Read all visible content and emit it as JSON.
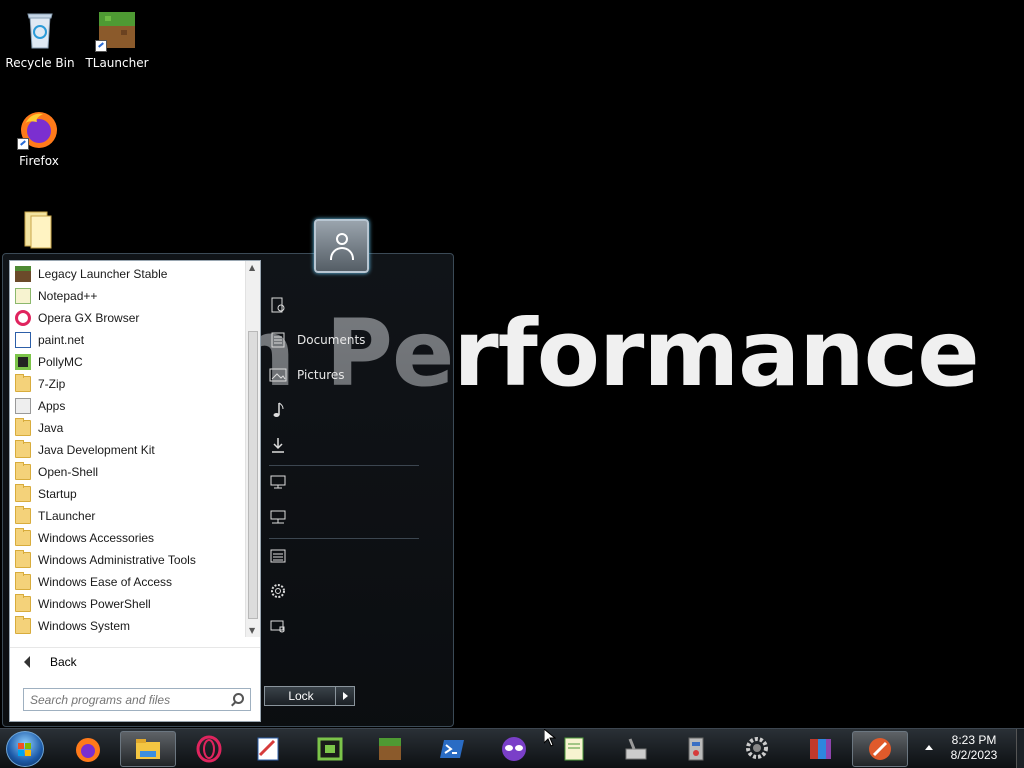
{
  "desktop": {
    "icons": [
      {
        "label": "Recycle Bin"
      },
      {
        "label": "TLauncher"
      },
      {
        "label": "Firefox"
      }
    ],
    "wallpaper_text": "n Performance"
  },
  "start_menu": {
    "programs": [
      {
        "label": "Legacy Launcher Stable",
        "icon": "minecraft-block-icon"
      },
      {
        "label": "Notepad++",
        "icon": "notepadpp-icon"
      },
      {
        "label": "Opera GX Browser",
        "icon": "opera-icon"
      },
      {
        "label": "paint.net",
        "icon": "paintnet-icon"
      },
      {
        "label": "PollyMC",
        "icon": "pollymc-icon"
      },
      {
        "label": "7-Zip",
        "icon": "folder-icon"
      },
      {
        "label": "Apps",
        "icon": "apps-icon"
      },
      {
        "label": "Java",
        "icon": "folder-icon"
      },
      {
        "label": "Java Development Kit",
        "icon": "folder-icon"
      },
      {
        "label": "Open-Shell",
        "icon": "folder-icon"
      },
      {
        "label": "Startup",
        "icon": "folder-icon"
      },
      {
        "label": "TLauncher",
        "icon": "folder-icon"
      },
      {
        "label": "Windows Accessories",
        "icon": "folder-icon"
      },
      {
        "label": "Windows Administrative Tools",
        "icon": "folder-icon"
      },
      {
        "label": "Windows Ease of Access",
        "icon": "folder-icon"
      },
      {
        "label": "Windows PowerShell",
        "icon": "folder-icon"
      },
      {
        "label": "Windows System",
        "icon": "folder-icon"
      }
    ],
    "back_label": "Back",
    "search_placeholder": "Search programs and files",
    "right_items": [
      {
        "label": "",
        "icon": "user-files-icon"
      },
      {
        "label": "Documents",
        "icon": "document-icon"
      },
      {
        "label": "Pictures",
        "icon": "picture-icon"
      },
      {
        "label": "",
        "icon": "music-icon"
      },
      {
        "label": "",
        "icon": "download-icon"
      },
      {
        "label": "",
        "icon": "computer-icon"
      },
      {
        "label": "",
        "icon": "network-icon"
      },
      {
        "label": "",
        "icon": "control-panel-icon"
      },
      {
        "label": "",
        "icon": "settings-icon"
      },
      {
        "label": "",
        "icon": "security-icon"
      }
    ],
    "lock_label": "Lock"
  },
  "taskbar": {
    "pinned": [
      "firefox-icon",
      "file-explorer-icon",
      "opera-icon",
      "paintnet-icon",
      "pollymc-icon",
      "minecraft-icon",
      "powershell-icon",
      "mask-app-icon",
      "notepadpp-icon",
      "tools-icon",
      "registry-icon",
      "settings-icon",
      "winrar-icon",
      "active-app-icon"
    ],
    "time": "8:23 PM",
    "date": "8/2/2023"
  }
}
